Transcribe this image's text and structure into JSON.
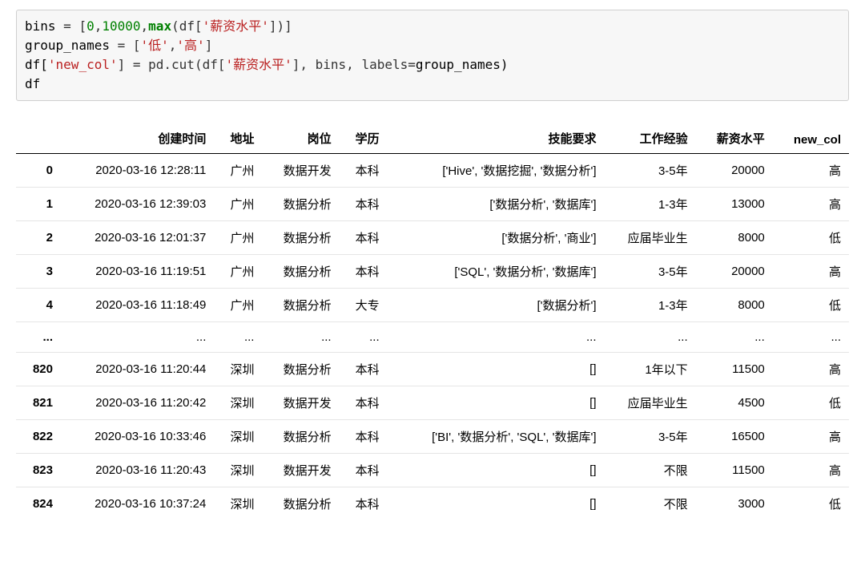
{
  "code": {
    "line1_pre": "bins ",
    "line1_eq": "= [",
    "line1_n0": "0",
    "line1_c1": ",",
    "line1_n1": "10000",
    "line1_c2": ",",
    "line1_max": "max",
    "line1_open": "(df[",
    "line1_s1": "'薪资水平'",
    "line1_close": "])]",
    "line2_pre": "group_names ",
    "line2_eq": "= [",
    "line2_s1": "'低'",
    "line2_c": ",",
    "line2_s2": "'高'",
    "line2_close": "]",
    "line3_dfopen": "df[",
    "line3_s1": "'new_col'",
    "line3_mid": "] ",
    "line3_eq": "= pd.cut(df[",
    "line3_s2": "'薪资水平'",
    "line3_tail": "], bins, labels",
    "line3_eq2": "=",
    "line3_gn": "group_names)",
    "line4": "df"
  },
  "columns": [
    "",
    "创建时间",
    "地址",
    "岗位",
    "学历",
    "技能要求",
    "工作经验",
    "薪资水平",
    "new_col"
  ],
  "rows": [
    {
      "idx": "0",
      "创建时间": "2020-03-16 12:28:11",
      "地址": "广州",
      "岗位": "数据开发",
      "学历": "本科",
      "技能要求": "['Hive', '数据挖掘', '数据分析']",
      "工作经验": "3-5年",
      "薪资水平": "20000",
      "new_col": "高"
    },
    {
      "idx": "1",
      "创建时间": "2020-03-16 12:39:03",
      "地址": "广州",
      "岗位": "数据分析",
      "学历": "本科",
      "技能要求": "['数据分析', '数据库']",
      "工作经验": "1-3年",
      "薪资水平": "13000",
      "new_col": "高"
    },
    {
      "idx": "2",
      "创建时间": "2020-03-16 12:01:37",
      "地址": "广州",
      "岗位": "数据分析",
      "学历": "本科",
      "技能要求": "['数据分析', '商业']",
      "工作经验": "应届毕业生",
      "薪资水平": "8000",
      "new_col": "低"
    },
    {
      "idx": "3",
      "创建时间": "2020-03-16 11:19:51",
      "地址": "广州",
      "岗位": "数据分析",
      "学历": "本科",
      "技能要求": "['SQL', '数据分析', '数据库']",
      "工作经验": "3-5年",
      "薪资水平": "20000",
      "new_col": "高"
    },
    {
      "idx": "4",
      "创建时间": "2020-03-16 11:18:49",
      "地址": "广州",
      "岗位": "数据分析",
      "学历": "大专",
      "技能要求": "['数据分析']",
      "工作经验": "1-3年",
      "薪资水平": "8000",
      "new_col": "低"
    },
    {
      "idx": "...",
      "创建时间": "...",
      "地址": "...",
      "岗位": "...",
      "学历": "...",
      "技能要求": "...",
      "工作经验": "...",
      "薪资水平": "...",
      "new_col": "..."
    },
    {
      "idx": "820",
      "创建时间": "2020-03-16 11:20:44",
      "地址": "深圳",
      "岗位": "数据分析",
      "学历": "本科",
      "技能要求": "[]",
      "工作经验": "1年以下",
      "薪资水平": "11500",
      "new_col": "高"
    },
    {
      "idx": "821",
      "创建时间": "2020-03-16 11:20:42",
      "地址": "深圳",
      "岗位": "数据开发",
      "学历": "本科",
      "技能要求": "[]",
      "工作经验": "应届毕业生",
      "薪资水平": "4500",
      "new_col": "低"
    },
    {
      "idx": "822",
      "创建时间": "2020-03-16 10:33:46",
      "地址": "深圳",
      "岗位": "数据分析",
      "学历": "本科",
      "技能要求": "['BI', '数据分析', 'SQL', '数据库']",
      "工作经验": "3-5年",
      "薪资水平": "16500",
      "new_col": "高"
    },
    {
      "idx": "823",
      "创建时间": "2020-03-16 11:20:43",
      "地址": "深圳",
      "岗位": "数据开发",
      "学历": "本科",
      "技能要求": "[]",
      "工作经验": "不限",
      "薪资水平": "11500",
      "new_col": "高"
    },
    {
      "idx": "824",
      "创建时间": "2020-03-16 10:37:24",
      "地址": "深圳",
      "岗位": "数据分析",
      "学历": "本科",
      "技能要求": "[]",
      "工作经验": "不限",
      "薪资水平": "3000",
      "new_col": "低"
    }
  ]
}
